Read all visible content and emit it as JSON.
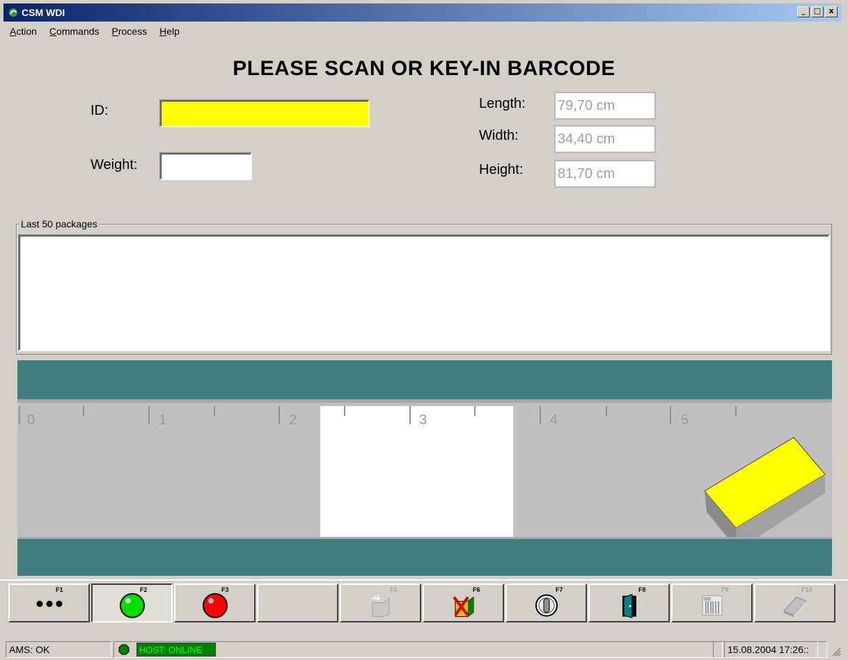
{
  "window": {
    "title": "CSM WDI",
    "controls": {
      "minimize": "_",
      "maximize": "□",
      "close": "x"
    }
  },
  "menu": {
    "items": [
      {
        "label": "Action",
        "mnemonic": "A"
      },
      {
        "label": "Commands",
        "mnemonic": "C"
      },
      {
        "label": "Process",
        "mnemonic": "P"
      },
      {
        "label": "Help",
        "mnemonic": "H"
      }
    ]
  },
  "heading": "PLEASE SCAN OR KEY-IN BARCODE",
  "form": {
    "id_label": "ID:",
    "id_value": "",
    "id_color": "#ffff00",
    "weight_label": "Weight:",
    "weight_value": "",
    "length_label": "Length:",
    "length_value": "79,70 cm",
    "width_label": "Width:",
    "width_value": "34,40 cm",
    "height_label": "Height:",
    "height_value": "81,70 cm"
  },
  "packages": {
    "group_label": "Last 50 packages",
    "items": []
  },
  "conveyor": {
    "scale_labels": [
      "0",
      "1",
      "2",
      "3",
      "4",
      "5"
    ],
    "belt_color": "#c0c0c0",
    "stripe_color": "#3f7f7f",
    "package_color": "#ffff00"
  },
  "toolbar": {
    "buttons": [
      {
        "key": "F1",
        "icon": "more-dots-icon",
        "state": "normal"
      },
      {
        "key": "F2",
        "icon": "green-light-icon",
        "state": "pressed"
      },
      {
        "key": "F3",
        "icon": "red-light-icon",
        "state": "normal"
      },
      {
        "key": "",
        "icon": "",
        "state": "normal"
      },
      {
        "key": "F5",
        "icon": "new-package-icon",
        "state": "disabled"
      },
      {
        "key": "F6",
        "icon": "delete-package-icon",
        "state": "normal"
      },
      {
        "key": "F7",
        "icon": "dial-icon",
        "state": "normal"
      },
      {
        "key": "F8",
        "icon": "exit-door-icon",
        "state": "normal"
      },
      {
        "key": "F9",
        "icon": "barcode-icon",
        "state": "disabled"
      },
      {
        "key": "F10",
        "icon": "book-icon",
        "state": "disabled"
      }
    ]
  },
  "status": {
    "ams": "AMS: OK",
    "host": "HOST: ONLINE",
    "datetime": "15.08.2004 17:26::"
  }
}
